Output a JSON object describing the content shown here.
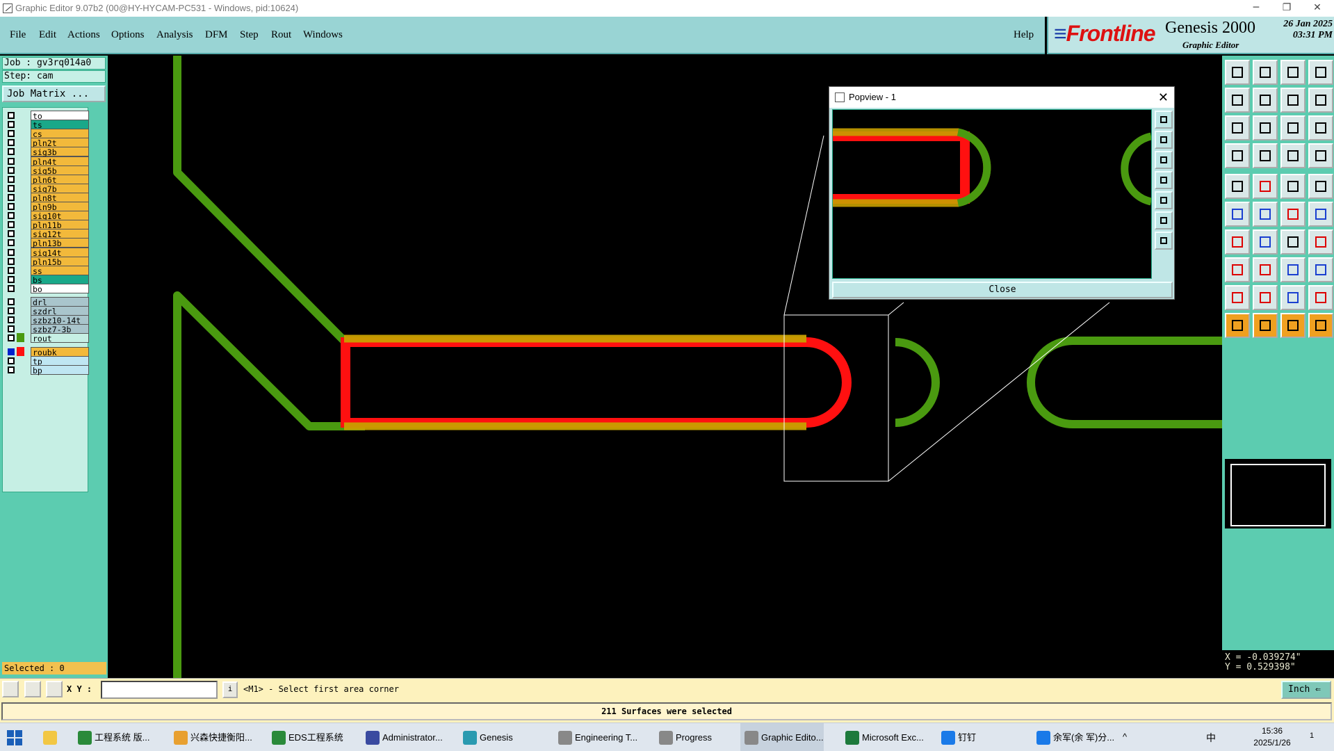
{
  "window": {
    "title": "Graphic Editor 9.07b2 (00@HY-HYCAM-PC531 - Windows, pid:10624)",
    "min_glyph": "─",
    "restore_glyph": "❐",
    "close_glyph": "✕"
  },
  "menu": {
    "items": [
      "File",
      "Edit",
      "Actions",
      "Options",
      "Analysis",
      "DFM",
      "Step",
      "Rout",
      "Windows"
    ],
    "help": "Help"
  },
  "brand": {
    "logo_lines": "≡",
    "logo": "Frontline",
    "product": "Genesis 2000",
    "subtitle": "Graphic Editor",
    "date": "26 Jan 2025",
    "time": "03:31 PM"
  },
  "left": {
    "job": "Job : gv3rq014a0",
    "step": "Step: cam",
    "job_matrix": "Job Matrix ...",
    "layers": [
      {
        "name": "to",
        "color": "#ffffff",
        "checked": false,
        "sw": ""
      },
      {
        "name": "ts",
        "color": "#1aa889",
        "checked": false,
        "sw": ""
      },
      {
        "name": "cs",
        "color": "#f2b93b",
        "checked": false,
        "sw": ""
      },
      {
        "name": "pln2t",
        "color": "#f2b93b",
        "checked": false,
        "sw": ""
      },
      {
        "name": "sig3b",
        "color": "#f2b93b",
        "checked": false,
        "sw": ""
      },
      {
        "name": "pln4t",
        "color": "#f2b93b",
        "checked": false,
        "sw": ""
      },
      {
        "name": "sig5b",
        "color": "#f2b93b",
        "checked": false,
        "sw": ""
      },
      {
        "name": "pln6t",
        "color": "#f2b93b",
        "checked": false,
        "sw": ""
      },
      {
        "name": "sig7b",
        "color": "#f2b93b",
        "checked": false,
        "sw": ""
      },
      {
        "name": "pln8t",
        "color": "#f2b93b",
        "checked": false,
        "sw": ""
      },
      {
        "name": "pln9b",
        "color": "#f2b93b",
        "checked": false,
        "sw": ""
      },
      {
        "name": "sig10t",
        "color": "#f2b93b",
        "checked": false,
        "sw": ""
      },
      {
        "name": "pln11b",
        "color": "#f2b93b",
        "checked": false,
        "sw": ""
      },
      {
        "name": "sig12t",
        "color": "#f2b93b",
        "checked": false,
        "sw": ""
      },
      {
        "name": "pln13b",
        "color": "#f2b93b",
        "checked": false,
        "sw": ""
      },
      {
        "name": "sig14t",
        "color": "#f2b93b",
        "checked": false,
        "sw": ""
      },
      {
        "name": "pln15b",
        "color": "#f2b93b",
        "checked": false,
        "sw": ""
      },
      {
        "name": "ss",
        "color": "#f2b93b",
        "checked": false,
        "sw": ""
      },
      {
        "name": "bs",
        "color": "#1aa889",
        "checked": false,
        "sw": ""
      },
      {
        "name": "bo",
        "color": "#ffffff",
        "checked": false,
        "sw": ""
      },
      {
        "name": "drl",
        "color": "#a9c5cc",
        "checked": false,
        "sw": ""
      },
      {
        "name": "szdrl",
        "color": "#a9c5cc",
        "checked": false,
        "sw": ""
      },
      {
        "name": "szbz10-14t",
        "color": "#a9c5cc",
        "checked": false,
        "sw": ""
      },
      {
        "name": "szbz7-3b",
        "color": "#a9c5cc",
        "checked": false,
        "sw": ""
      },
      {
        "name": "rout",
        "color": "#c6efe4",
        "checked": false,
        "sw": "#4a9a10"
      },
      {
        "name": "roubk",
        "color": "#f2b93b",
        "checked": true,
        "sw": "#ff1010"
      },
      {
        "name": "tp",
        "color": "#bfe6f2",
        "checked": false,
        "sw": ""
      },
      {
        "name": "bp",
        "color": "#bfe6f2",
        "checked": false,
        "sw": ""
      }
    ],
    "selected": "Selected : 0"
  },
  "popview": {
    "title": "Popview - 1",
    "close_label": "Close",
    "close_glyph": "✕"
  },
  "coords": {
    "x": "X = -0.039274\"",
    "y": "Y =  0.529398\""
  },
  "cmd": {
    "xy_label": "X Y :",
    "xy_value": "",
    "info_icon": "i",
    "prompt": "<M1> - Select first area corner",
    "unit": "Inch ⇐"
  },
  "status": {
    "message": "211 Surfaces were selected"
  },
  "taskbar": {
    "tasks": [
      {
        "label": "工程系统    版...",
        "icon": "#2a8a3a"
      },
      {
        "label": "兴森快捷衡阳...",
        "icon": "#e8a030"
      },
      {
        "label": "EDS工程系统",
        "icon": "#2a8a3a"
      },
      {
        "label": "Administrator...",
        "icon": "#3a4aa0"
      },
      {
        "label": "Genesis",
        "icon": "#2a9ab0"
      },
      {
        "label": "Engineering T...",
        "icon": "#888"
      },
      {
        "label": "Progress",
        "icon": "#888"
      },
      {
        "label": "Graphic Edito...",
        "icon": "#888"
      },
      {
        "label": "Microsoft Exc...",
        "icon": "#1d7a3c"
      },
      {
        "label": "钉钉",
        "icon": "#1a7ae8"
      },
      {
        "label": "余军(余  军)分...",
        "icon": "#1a7ae8"
      }
    ],
    "tray_caret": "^",
    "ime": "中",
    "time": "15:36",
    "date": "2025/1/26",
    "notif_count": "1"
  }
}
